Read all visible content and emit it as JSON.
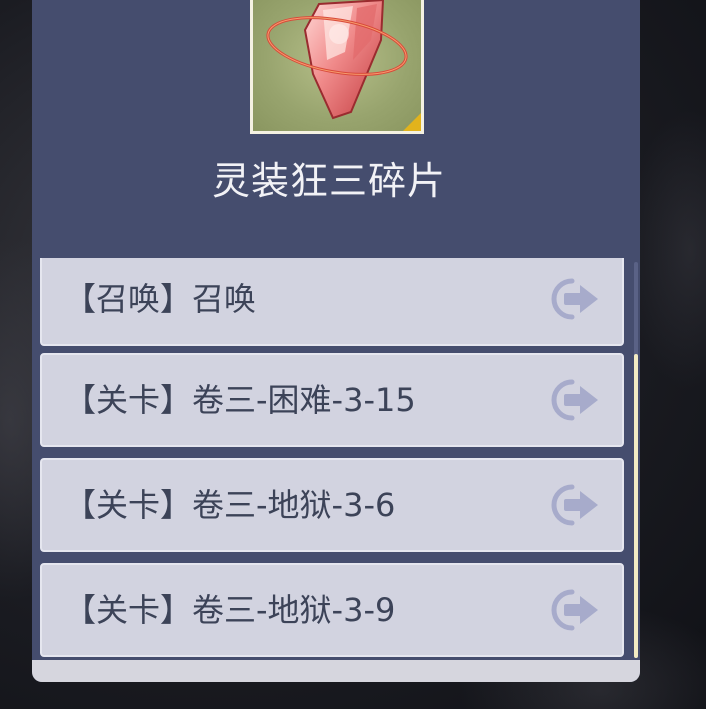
{
  "item": {
    "name": "灵装狂三碎片",
    "icon": "crystal-shard-icon",
    "rarity_color": "#e2b31c"
  },
  "sources": [
    {
      "label": "【召唤】召唤",
      "icon": "go-arrow-icon"
    },
    {
      "label": "【关卡】卷三-困难-3-15",
      "icon": "go-arrow-icon"
    },
    {
      "label": "【关卡】卷三-地狱-3-6",
      "icon": "go-arrow-icon"
    },
    {
      "label": "【关卡】卷三-地狱-3-9",
      "icon": "go-arrow-icon"
    }
  ],
  "colors": {
    "panel": "#454d6e",
    "row": "#d2d3e0",
    "row_text": "#3c4358",
    "arrow": "#a7abcb",
    "scroll_thumb": "#f3ecc4"
  }
}
